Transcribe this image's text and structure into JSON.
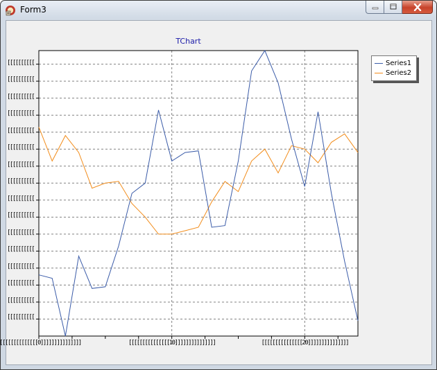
{
  "window": {
    "title": "Form3",
    "app_icon": "delphi-app-icon",
    "controls": {
      "minimize": "minimize-icon",
      "maximize": "maximize-icon",
      "close": "close-icon"
    }
  },
  "colors": {
    "series1": "#3a5ba8",
    "series2": "#f28c1a",
    "chart_title": "#1a1aa8",
    "grid": "#808080"
  },
  "chart_data": {
    "type": "line",
    "title": "TChart",
    "xlabel": "",
    "ylabel": "",
    "grid": true,
    "legend_position": "right",
    "x": [
      0,
      1,
      2,
      3,
      4,
      5,
      6,
      7,
      8,
      9,
      10,
      11,
      12,
      13,
      14,
      15,
      16,
      17,
      18,
      19,
      20,
      21,
      22,
      23,
      24
    ],
    "xlim": [
      0,
      24
    ],
    "ylim": [
      0,
      16.8
    ],
    "yticks": [
      1,
      2,
      3,
      4,
      5,
      6,
      7,
      8,
      9,
      10,
      11,
      12,
      13,
      14,
      15,
      16
    ],
    "ytick_label": "[[[[[[[[[[[[[[[",
    "xticks": [
      {
        "value": 0,
        "label": "[[[[[[[[[[[[[[[0]]]]]]]]]]]]]]]"
      },
      {
        "value": 10,
        "label": "[[[[[[[[[[[[[[[10]]]]]]]]]]]]]]]"
      },
      {
        "value": 20,
        "label": "[[[[[[[[[[[[[[[20]]]]]]]]]]]]]]]"
      }
    ],
    "series": [
      {
        "name": "Series1",
        "values": [
          3.6,
          3.4,
          0.0,
          4.7,
          2.8,
          2.9,
          5.3,
          8.4,
          9.0,
          13.3,
          10.3,
          10.8,
          10.9,
          6.4,
          6.5,
          10.3,
          15.6,
          16.8,
          14.9,
          11.6,
          8.8,
          13.2,
          8.4,
          4.4,
          0.9
        ],
        "color": "#3a5ba8"
      },
      {
        "name": "Series2",
        "values": [
          12.3,
          10.3,
          11.8,
          10.8,
          8.7,
          9.0,
          9.1,
          7.8,
          7.0,
          6.0,
          6.0,
          6.2,
          6.4,
          7.9,
          9.1,
          8.5,
          10.3,
          11.0,
          9.6,
          11.2,
          11.0,
          10.2,
          11.4,
          11.9,
          10.8
        ],
        "color": "#f28c1a"
      }
    ]
  }
}
